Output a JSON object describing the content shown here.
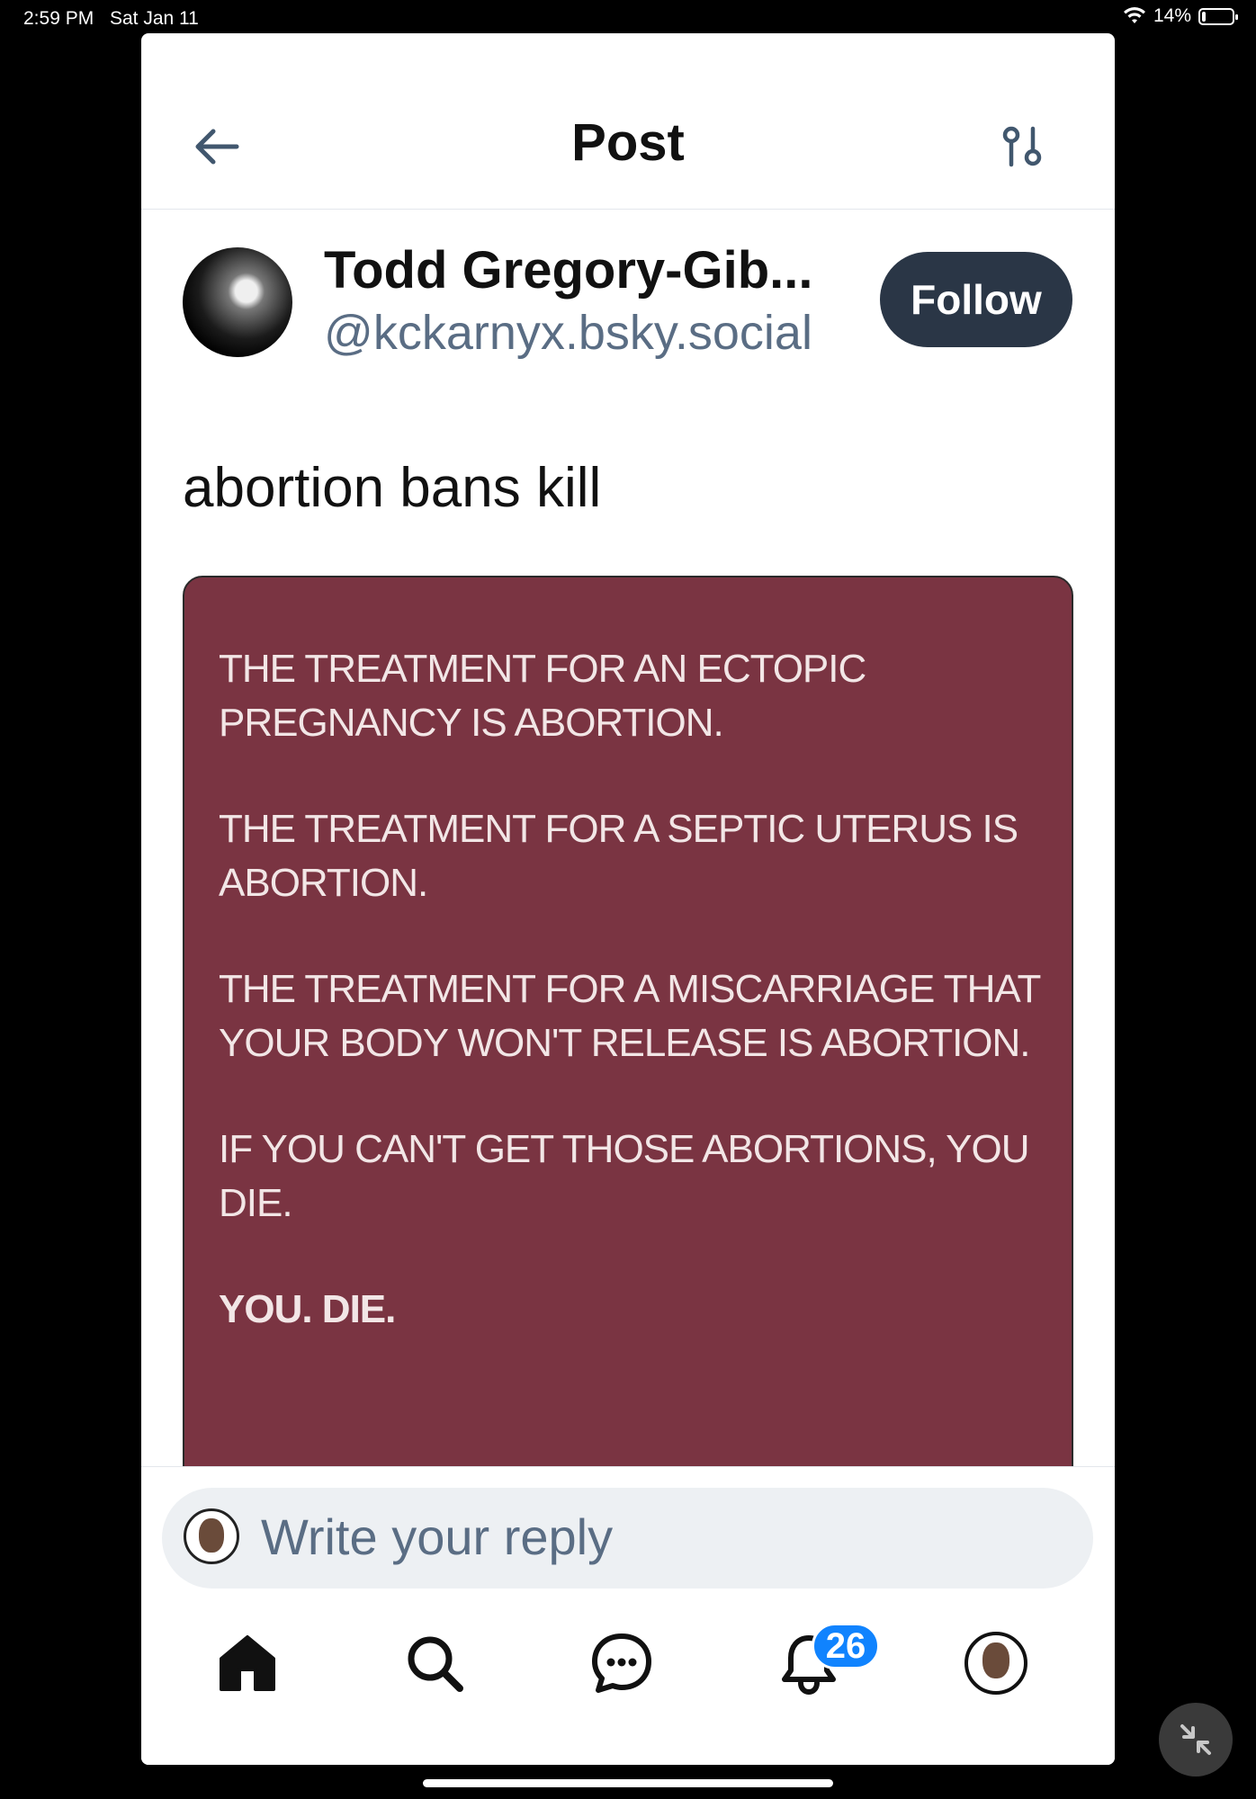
{
  "status_bar": {
    "time": "2:59 PM",
    "date": "Sat Jan 11",
    "battery": "14%",
    "battery_level": 0.14
  },
  "header": {
    "title": "Post"
  },
  "post": {
    "author_name": "Todd Gregory-Gib...",
    "author_handle": "@kckarnyx.bsky.social",
    "follow_label": "Follow",
    "text": "abortion bans kill",
    "image_text": [
      "THE TREATMENT FOR AN ECTOPIC PREGNANCY IS ABORTION.",
      "THE TREATMENT FOR A SEPTIC UTERUS IS ABORTION.",
      "THE TREATMENT FOR A MISCARRIAGE THAT YOUR BODY WON'T RELEASE IS ABORTION.",
      "IF YOU CAN'T GET THOSE ABORTIONS, YOU DIE.",
      "YOU. DIE."
    ],
    "image_color": "#7a3442"
  },
  "reply": {
    "placeholder": "Write your reply"
  },
  "tabbar": {
    "tabs": [
      {
        "icon": "home-icon"
      },
      {
        "icon": "search-icon"
      },
      {
        "icon": "chat-icon"
      },
      {
        "icon": "bell-icon"
      },
      {
        "icon": "profile-avatar"
      }
    ],
    "notifications_badge": "26"
  },
  "colors": {
    "accent": "#1083fe",
    "follow_button": "#2a3646",
    "secondary_text": "#5a6d84"
  }
}
